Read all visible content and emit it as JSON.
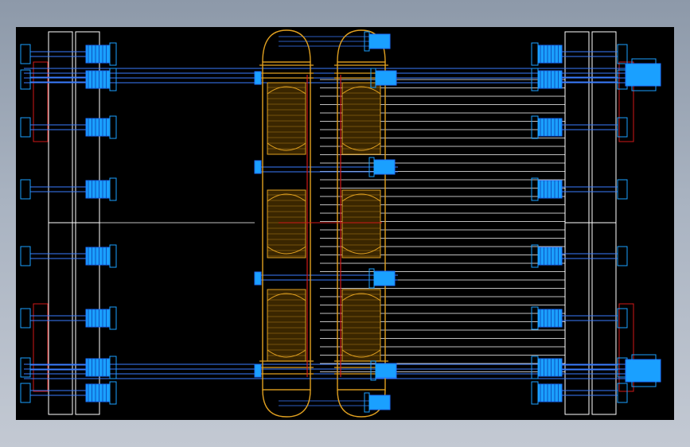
{
  "viewport": {
    "background": "#000000",
    "description_text": ""
  },
  "palette": {
    "frame": "#ffffff",
    "bolt": "#1e6fff",
    "bolt_head": "#1aa0ff",
    "rod": "#3a7dff",
    "pipe": "#e0a020",
    "pipe_fill": "#3a2600",
    "red": "#d01818",
    "grid": "#ffffff"
  },
  "components": {
    "left_frame": "frame-plate-left",
    "right_frame": "frame-plate-right",
    "center_pipes": [
      "pipe-column-left",
      "pipe-column-right"
    ],
    "bolt_rows": 8
  }
}
